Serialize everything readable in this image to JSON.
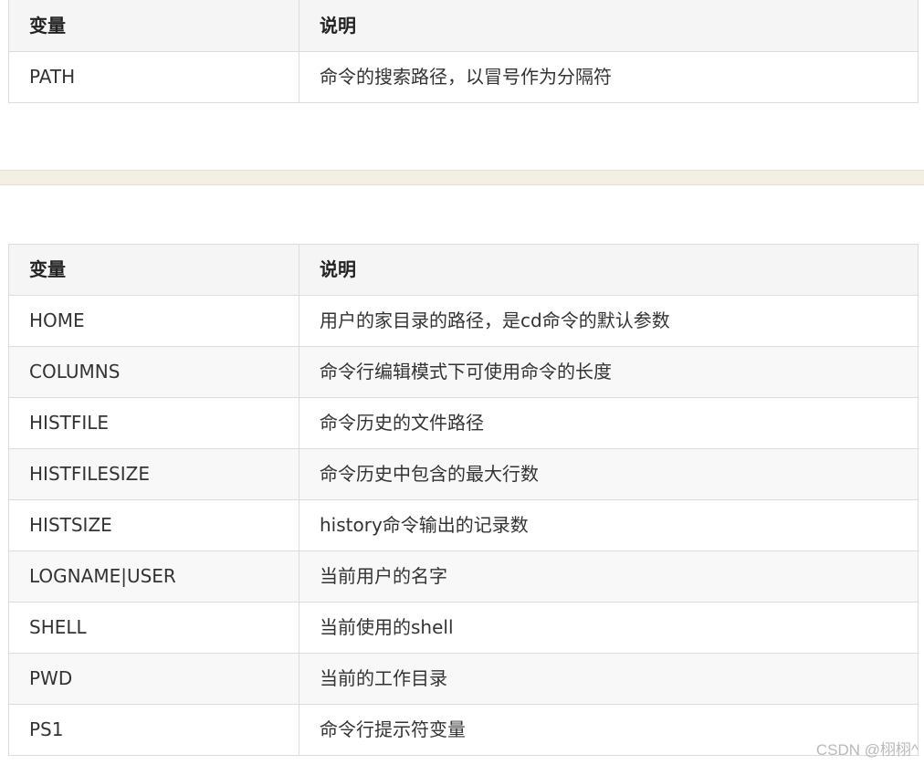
{
  "table_top": {
    "headers": [
      "变量",
      "说明"
    ],
    "rows": [
      [
        "PATH",
        "命令的搜索路径，以冒号作为分隔符"
      ]
    ]
  },
  "table_main": {
    "headers": [
      "变量",
      "说明"
    ],
    "rows": [
      [
        "HOME",
        "用户的家目录的路径，是cd命令的默认参数"
      ],
      [
        "COLUMNS",
        "命令行编辑模式下可使用命令的长度"
      ],
      [
        "HISTFILE",
        "命令历史的文件路径"
      ],
      [
        "HISTFILESIZE",
        "命令历史中包含的最大行数"
      ],
      [
        "HISTSIZE",
        "history命令输出的记录数"
      ],
      [
        "LOGNAME|USER",
        "当前用户的名字"
      ],
      [
        "SHELL",
        "当前使用的shell"
      ],
      [
        "PWD",
        "当前的工作目录"
      ],
      [
        "PS1",
        "命令行提示符变量"
      ]
    ]
  },
  "watermark": "CSDN @栩栩^"
}
